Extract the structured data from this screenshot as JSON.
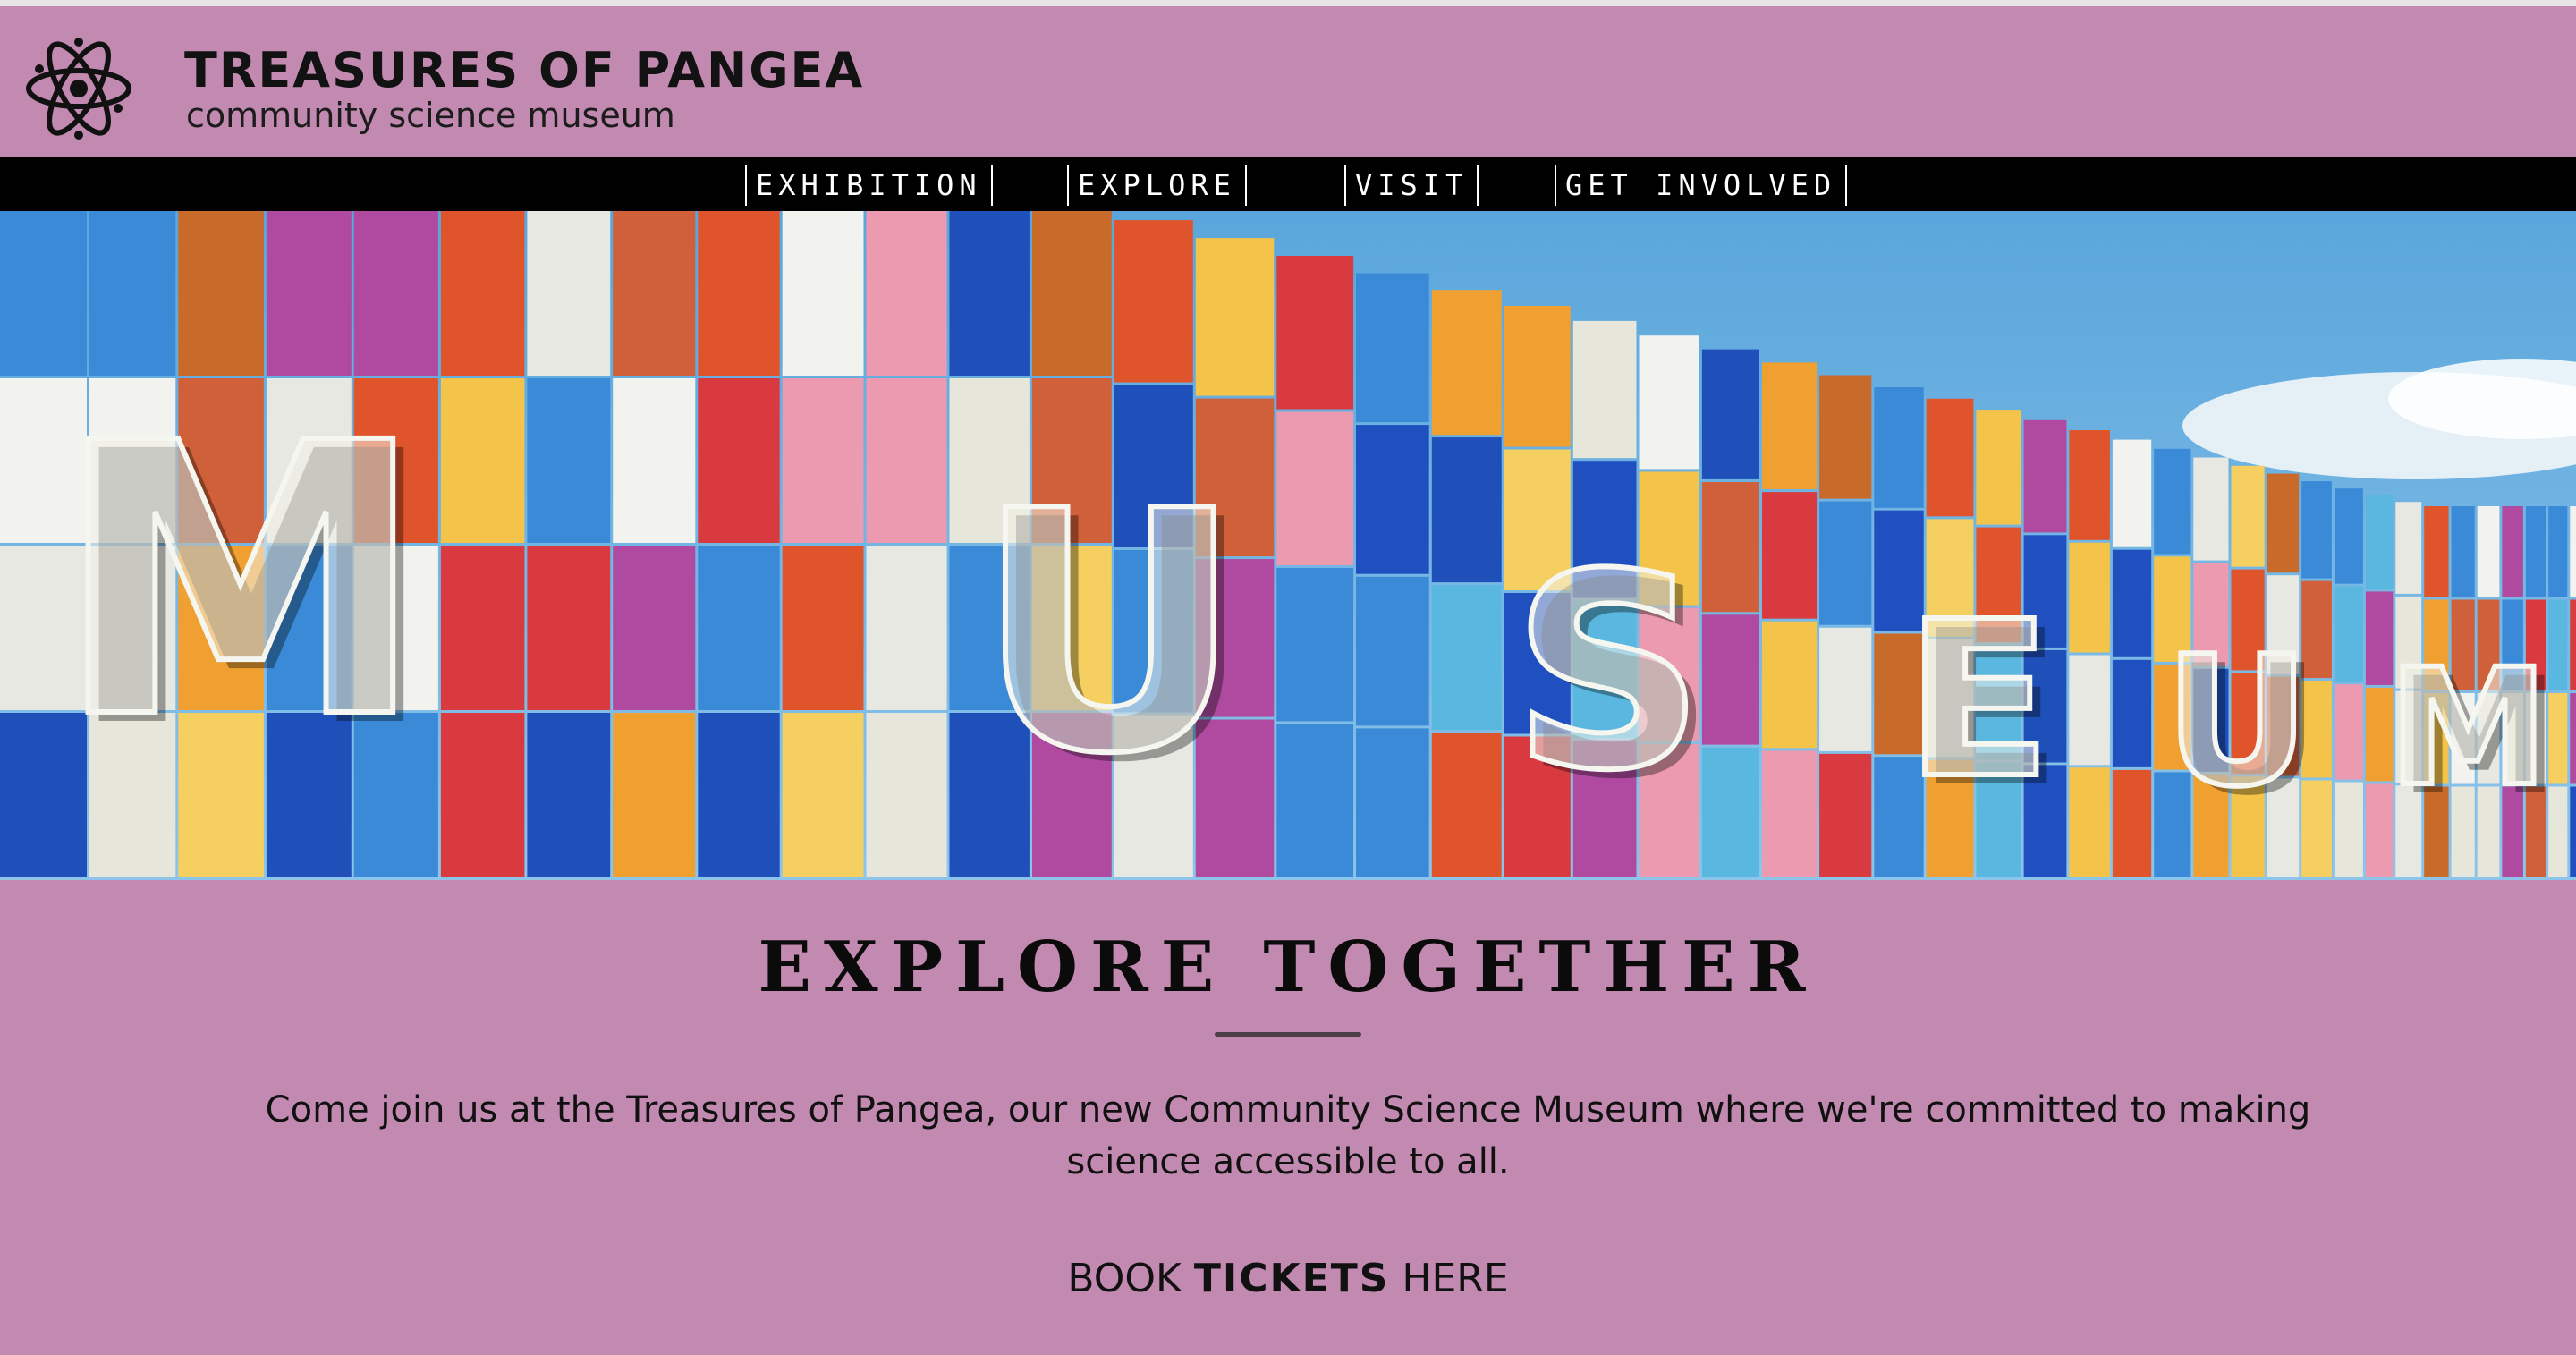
{
  "brand": {
    "title": "TREASURES OF PANGEA",
    "subtitle": "community science museum",
    "logo_icon": "atom-icon"
  },
  "nav": {
    "items": [
      {
        "label": "EXHIBITION"
      },
      {
        "label": "EXPLORE"
      },
      {
        "label": "VISIT"
      },
      {
        "label": "GET INVOLVED"
      }
    ]
  },
  "hero": {
    "sign_text": "MUSEUM"
  },
  "main": {
    "headline": "EXPLORE TOGETHER",
    "body": "Come join us at the Treasures of Pangea, our new Community Science Museum where we're committed to making science accessible to all.",
    "cta": {
      "prefix": "BOOK",
      "strong": "TICKETS",
      "suffix": "HERE"
    }
  },
  "colors": {
    "background": "#c28ab0",
    "nav_background": "#000000",
    "text": "#111111"
  }
}
